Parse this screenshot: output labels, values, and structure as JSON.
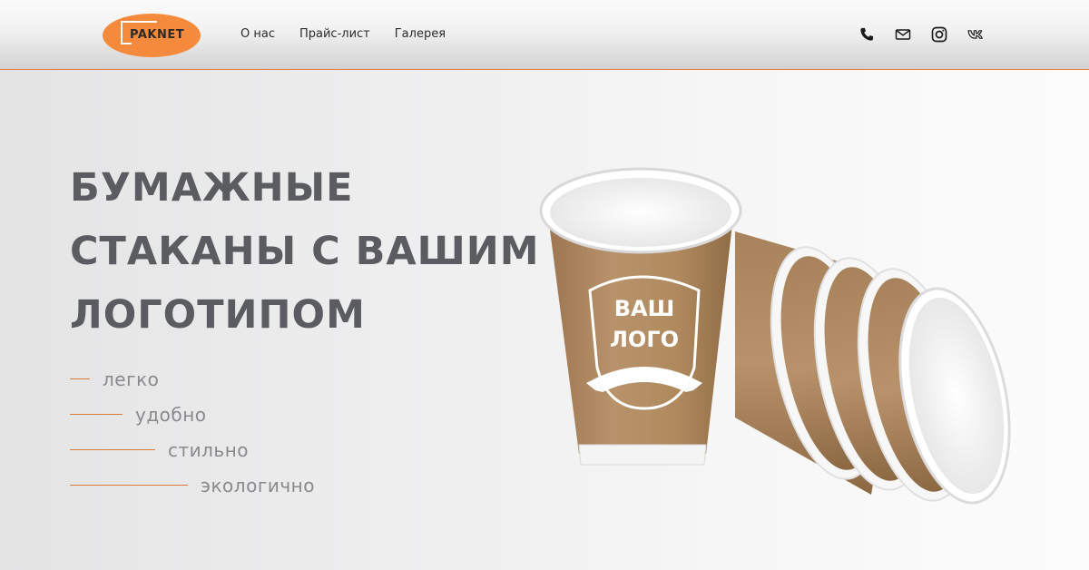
{
  "header": {
    "logo_text": "PAKNET",
    "nav": [
      {
        "label": "О нас"
      },
      {
        "label": "Прайс-лист"
      },
      {
        "label": "Галерея"
      }
    ],
    "icons": [
      "phone-icon",
      "mail-icon",
      "instagram-icon",
      "vk-icon"
    ]
  },
  "hero": {
    "title_lines": [
      "БУМАЖНЫЕ",
      "СТАКАНЫ С ВАШИМ",
      "ЛОГОТИПОМ"
    ],
    "features": [
      "легко",
      "удобно",
      "стильно",
      "экологично"
    ],
    "cup_logo_line1": "ВАШ",
    "cup_logo_line2": "ЛОГО"
  },
  "colors": {
    "accent": "#f58a3c",
    "title": "#5a5c60",
    "feature_text": "#8a8a8e",
    "kraft": "#b08a5e"
  }
}
